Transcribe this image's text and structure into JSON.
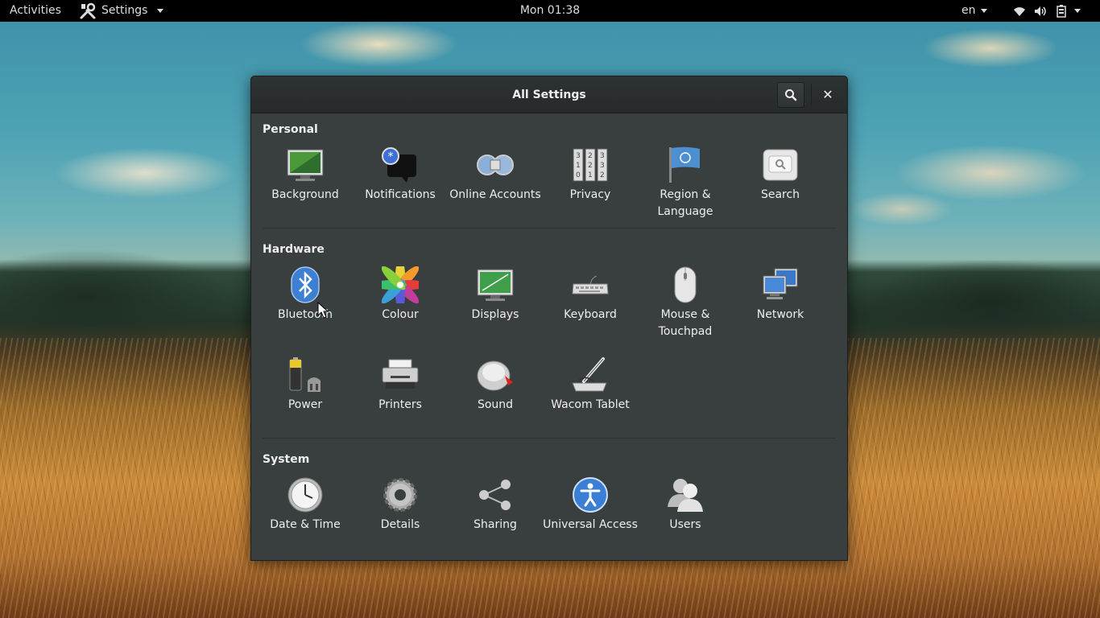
{
  "topbar": {
    "activities": "Activities",
    "app_menu": "Settings",
    "clock": "Mon 01:38",
    "language": "en"
  },
  "window": {
    "title": "All Settings",
    "sections": {
      "personal": {
        "title": "Personal",
        "items": [
          "Background",
          "Notifications",
          "Online Accounts",
          "Privacy",
          "Region & Language",
          "Search"
        ]
      },
      "hardware": {
        "title": "Hardware",
        "items": [
          "Bluetooth",
          "Colour",
          "Displays",
          "Keyboard",
          "Mouse & Touchpad",
          "Network",
          "Power",
          "Printers",
          "Sound",
          "Wacom Tablet"
        ]
      },
      "system": {
        "title": "System",
        "items": [
          "Date & Time",
          "Details",
          "Sharing",
          "Universal Access",
          "Users"
        ]
      }
    }
  },
  "colors": {
    "topbar_bg": "#000000",
    "window_bg": "#393f3f",
    "headerbar_bg": "#2b3030",
    "text": "#eeeeee",
    "bluetooth_blue": "#3d7fd3",
    "accessibility_blue": "#3a7fd5"
  }
}
